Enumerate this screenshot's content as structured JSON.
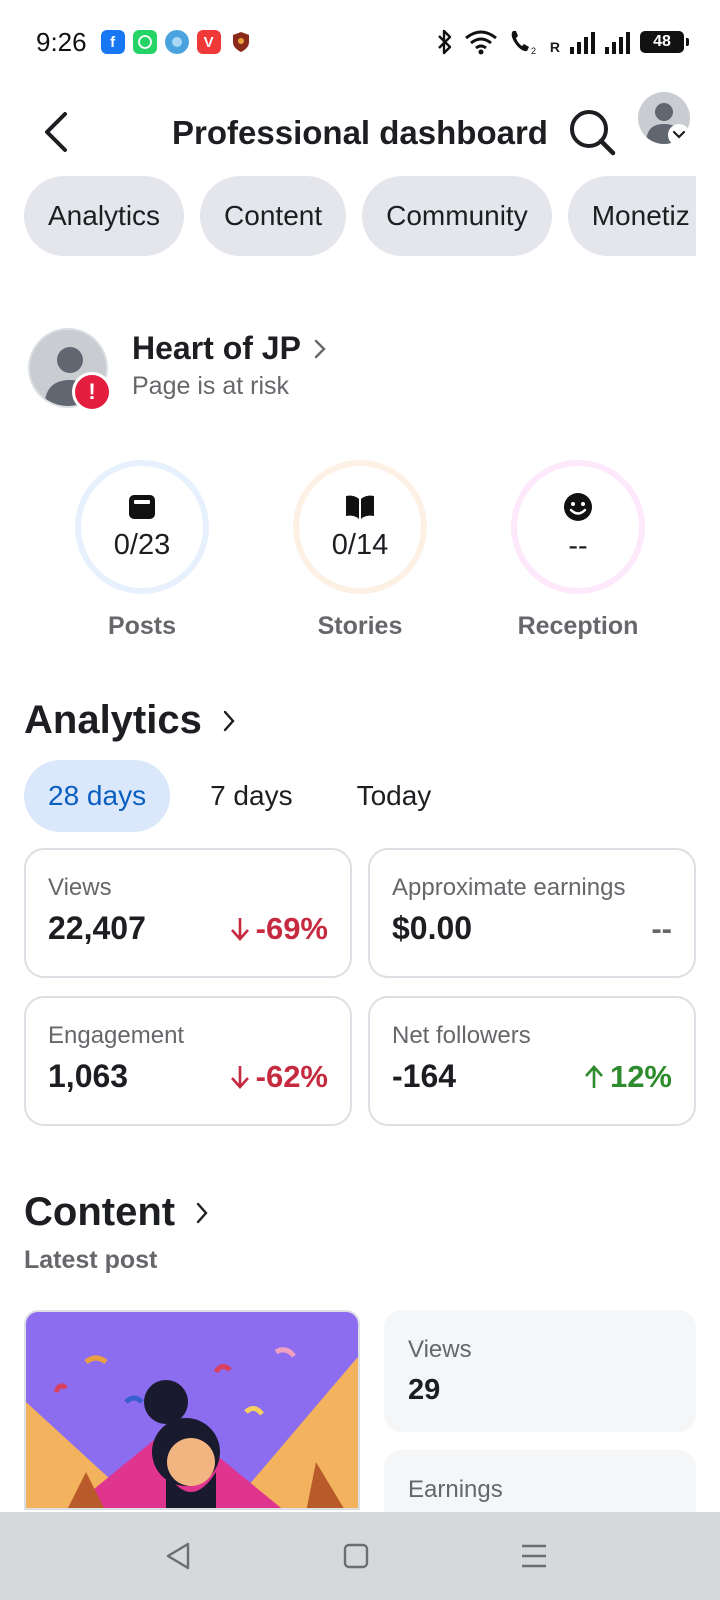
{
  "status_bar": {
    "time": "9:26",
    "battery": "48",
    "roaming_label": "R",
    "notification_icons": [
      "facebook-icon",
      "whatsapp-icon",
      "bird-app-icon",
      "vivaldi-icon",
      "shield-app-icon"
    ]
  },
  "header": {
    "title": "Professional dashboard"
  },
  "tabs": [
    {
      "label": "Analytics"
    },
    {
      "label": "Content"
    },
    {
      "label": "Community"
    },
    {
      "label": "Monetiz"
    }
  ],
  "profile": {
    "name": "Heart of JP",
    "status": "Page is at risk",
    "badge": "!"
  },
  "rings": [
    {
      "label": "Posts",
      "value": "0/23",
      "icon": "post-icon",
      "color": "#e7f0fd"
    },
    {
      "label": "Stories",
      "value": "0/14",
      "icon": "book-icon",
      "color": "#fdf0e4"
    },
    {
      "label": "Reception",
      "value": "--",
      "icon": "smiley-icon",
      "color": "#fde9fb"
    }
  ],
  "analytics": {
    "title": "Analytics",
    "ranges": [
      {
        "label": "28 days",
        "active": true
      },
      {
        "label": "7 days",
        "active": false
      },
      {
        "label": "Today",
        "active": false
      }
    ],
    "cards": [
      {
        "label": "Views",
        "value": "22,407",
        "change": "-69%",
        "direction": "down"
      },
      {
        "label": "Approximate earnings",
        "value": "$0.00",
        "change": "--",
        "direction": "none"
      },
      {
        "label": "Engagement",
        "value": "1,063",
        "change": "-62%",
        "direction": "down"
      },
      {
        "label": "Net followers",
        "value": "-164",
        "change": "12%",
        "direction": "up"
      }
    ]
  },
  "content": {
    "title": "Content",
    "subtitle": "Latest post",
    "metrics": [
      {
        "label": "Views",
        "value": "29"
      },
      {
        "label": "Earnings",
        "value": ""
      }
    ]
  },
  "colors": {
    "accent": "#0b5fc1",
    "negative": "#c62a3f",
    "positive": "#2e8b2e",
    "risk": "#e41e3f"
  }
}
